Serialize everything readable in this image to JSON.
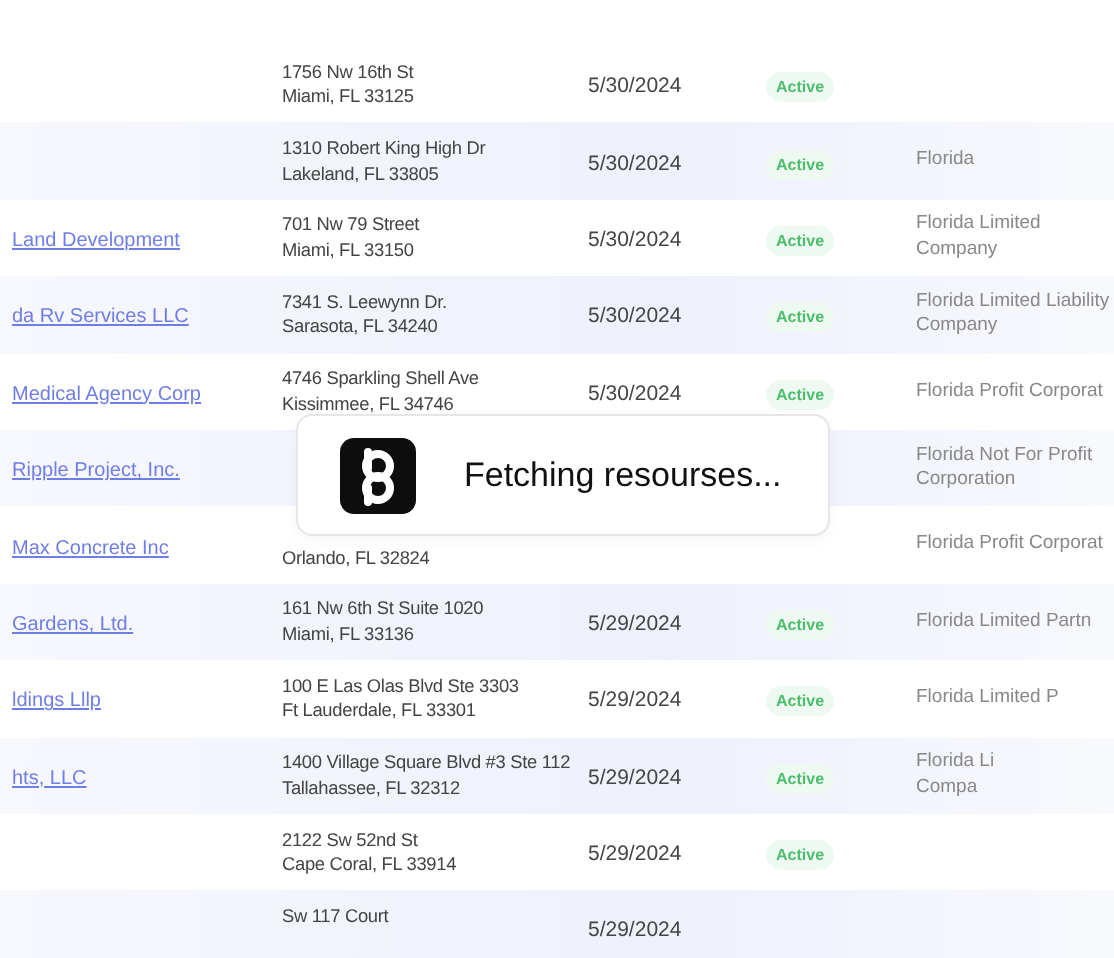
{
  "rows": [
    {
      "address": {
        "line1": "1756 Nw 16th St",
        "line2": "Miami, FL 33125"
      },
      "date": "5/30/2024",
      "status": "Active",
      "shaded": false
    },
    {
      "address": {
        "line1": "1310 Robert King High Dr",
        "line2": "Lakeland, FL 33805"
      },
      "date": "5/30/2024",
      "status": "Active",
      "type": [
        "Florida"
      ],
      "shaded": true
    },
    {
      "name": "Land Development",
      "address": {
        "line1": "701 Nw 79 Street",
        "line2": "Miami, FL 33150"
      },
      "date": "5/30/2024",
      "status": "Active",
      "type": [
        "Florida Limited",
        "Company"
      ],
      "shaded": false
    },
    {
      "name": "da Rv Services LLC",
      "address": {
        "line1": "7341 S. Leewynn Dr.",
        "line2": "Sarasota, FL 34240"
      },
      "date": "5/30/2024",
      "status": "Active",
      "type": [
        "Florida Limited Liability",
        "Company"
      ],
      "shaded": true
    },
    {
      "name": "Medical Agency Corp",
      "address": {
        "line1": "4746 Sparkling Shell Ave",
        "line2": "Kissimmee, FL 34746"
      },
      "date": "5/30/2024",
      "status": "Active",
      "type": [
        "Florida Profit Corporat"
      ],
      "shaded": false
    },
    {
      "name": "Ripple Project, Inc.",
      "address": {},
      "type": [
        "Florida Not For Profit",
        "Corporation"
      ],
      "shaded": true
    },
    {
      "name": "Max Concrete Inc",
      "address": {
        "line2": "Orlando, FL 32824"
      },
      "type": [
        "Florida Profit Corporat"
      ],
      "shaded": false
    },
    {
      "name": "Gardens, Ltd.",
      "address": {
        "line1": "161 Nw 6th St Suite 1020",
        "line2": "Miami, FL 33136"
      },
      "date": "5/29/2024",
      "status": "Active",
      "type": [
        "Florida Limited Partn"
      ],
      "shaded": true
    },
    {
      "name": "ldings Lllp",
      "address": {
        "line1": "100 E Las Olas Blvd Ste 3303",
        "line2": "Ft Lauderdale, FL 33301"
      },
      "date": "5/29/2024",
      "status": "Active",
      "type": [
        "Florida Limited P"
      ],
      "shaded": false
    },
    {
      "name": "hts, LLC",
      "address": {
        "line1": "1400 Village Square Blvd #3 Ste 112",
        "line2": "Tallahassee, FL 32312"
      },
      "date": "5/29/2024",
      "status": "Active",
      "type": [
        "Florida Li",
        "Compa"
      ],
      "shaded": true
    },
    {
      "address": {
        "line1": "2122 Sw 52nd St",
        "line2": "Cape Coral, FL 33914"
      },
      "date": "5/29/2024",
      "status": "Active",
      "shaded": false
    },
    {
      "address": {
        "line1": "Sw 117 Court"
      },
      "date": "5/29/2024",
      "shaded": true
    }
  ],
  "toast": {
    "message": "Fetching resourses..."
  }
}
